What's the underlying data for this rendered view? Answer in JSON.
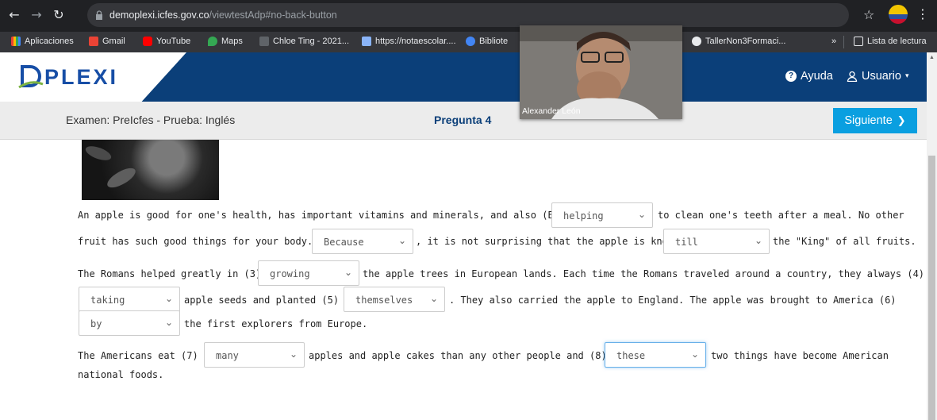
{
  "browser": {
    "url_host": "demoplexi.icfes.gov.co",
    "url_path": "/viewtestAdp#no-back-button",
    "bookmarks": [
      {
        "label": "Aplicaciones"
      },
      {
        "label": "Gmail"
      },
      {
        "label": "YouTube"
      },
      {
        "label": "Maps"
      },
      {
        "label": "Chloe Ting - 2021..."
      },
      {
        "label": "https://notaescolar...."
      },
      {
        "label": "Bibliote"
      },
      {
        "label": "TallerNon3Formaci..."
      },
      {
        "label": "»"
      },
      {
        "label": "Lista de lectura"
      }
    ]
  },
  "header": {
    "logo": "PLEXI",
    "help": "Ayuda",
    "user": "Usuario"
  },
  "exam_bar": {
    "title": "Examen: PreIcfes - Prueba: Inglés",
    "question": "Pregunta 4",
    "next_label": "Siguiente"
  },
  "video": {
    "participant": "Alexander León"
  },
  "passage": {
    "l1a": "An apple is good for one's health, has important vitamins and minerals, and also (Ejemplo)",
    "l1b": "to clean one's teeth after a meal. No other",
    "l2a": "fruit has such good things for your body. (1)",
    "l2b": ", it is not surprising that the apple is known (2)",
    "l2c": "the \"King\" of all fruits.",
    "l3a": "The Romans helped greatly in (3)",
    "l3b": "the apple trees in European lands. Each time the Romans traveled around a country, they always (4)",
    "l4a": "apple seeds and planted (5)",
    "l4b": ". They also carried the apple to England. The apple was brought to America (6)",
    "l5a": "the first explorers from Europe.",
    "l6a": "The Americans eat (7)",
    "l6b": "apples and apple cakes than any other people and (8)",
    "l6c": "two things have become American",
    "l7a": "national foods."
  },
  "selects": {
    "example": "helping",
    "q1": "Because",
    "q2": "till",
    "q3": "growing",
    "q4": "taking",
    "q5": "themselves",
    "q6": "by",
    "q7": "many",
    "q8": "these"
  }
}
